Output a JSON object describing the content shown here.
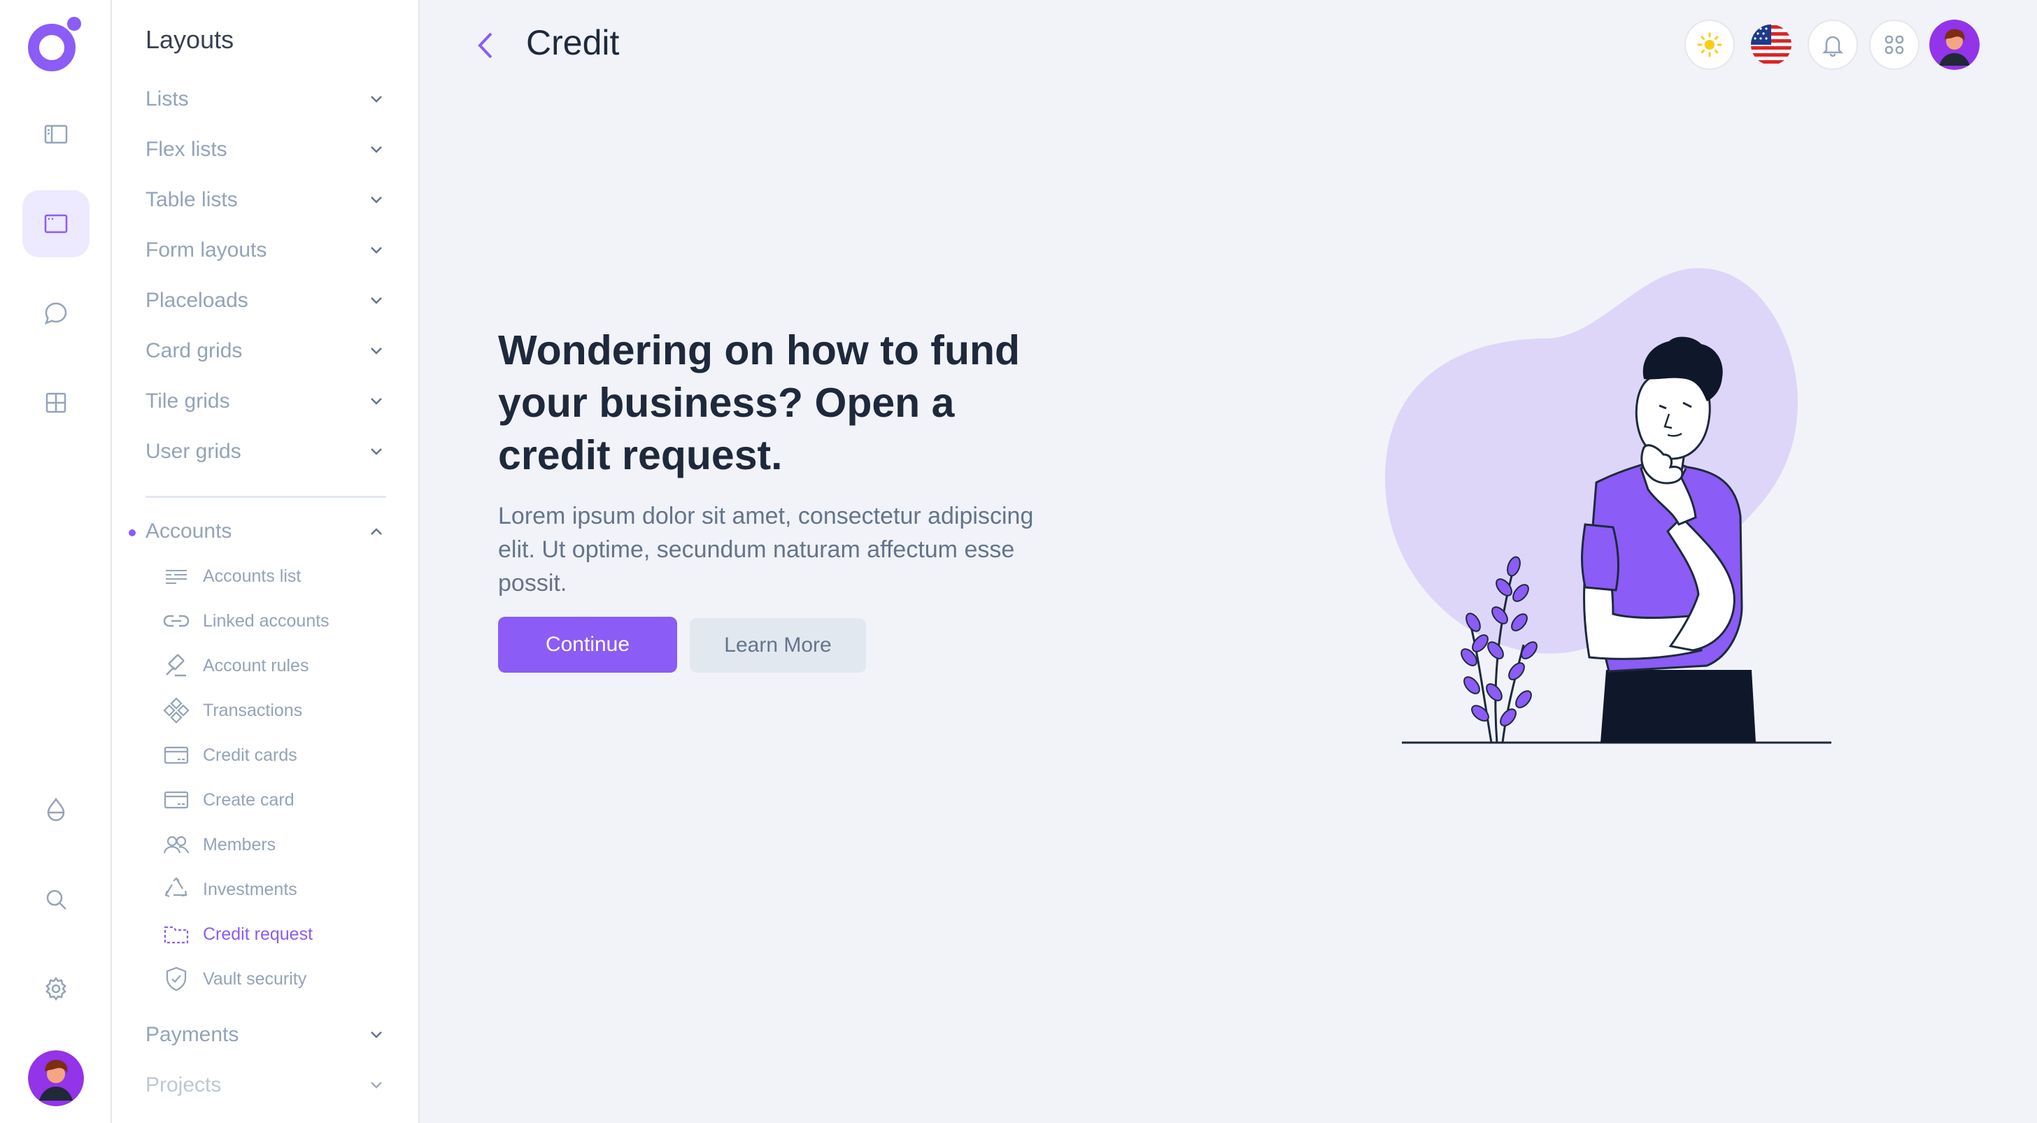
{
  "menu": {
    "title": "Layouts",
    "items": [
      {
        "label": "Lists"
      },
      {
        "label": "Flex lists"
      },
      {
        "label": "Table lists"
      },
      {
        "label": "Form layouts"
      },
      {
        "label": "Placeloads"
      },
      {
        "label": "Card grids"
      },
      {
        "label": "Tile grids"
      },
      {
        "label": "User grids"
      }
    ],
    "accounts": {
      "label": "Accounts",
      "sub_items": [
        {
          "label": "Accounts list",
          "icon": "list-icon"
        },
        {
          "label": "Linked accounts",
          "icon": "link-icon"
        },
        {
          "label": "Account rules",
          "icon": "gavel-icon"
        },
        {
          "label": "Transactions",
          "icon": "transactions-icon"
        },
        {
          "label": "Credit cards",
          "icon": "credit-card-icon"
        },
        {
          "label": "Create card",
          "icon": "create-card-icon"
        },
        {
          "label": "Members",
          "icon": "members-icon"
        },
        {
          "label": "Investments",
          "icon": "recycle-icon"
        },
        {
          "label": "Credit request",
          "icon": "credit-request-icon",
          "active": true
        },
        {
          "label": "Vault security",
          "icon": "shield-icon"
        }
      ]
    },
    "bottom_items": [
      {
        "label": "Payments"
      },
      {
        "label": "Projects"
      }
    ]
  },
  "header": {
    "title": "Credit"
  },
  "hero": {
    "title": "Wondering on how to fund your business? Open a credit request.",
    "text": "Lorem ipsum dolor sit amet, consectetur adipiscing elit. Ut optime, secundum naturam affectum esse possit.",
    "continue_label": "Continue",
    "learn_label": "Learn More"
  },
  "colors": {
    "accent": "#8b5cf6",
    "background": "#f1f3f9",
    "blob": "#ddd6f8"
  }
}
